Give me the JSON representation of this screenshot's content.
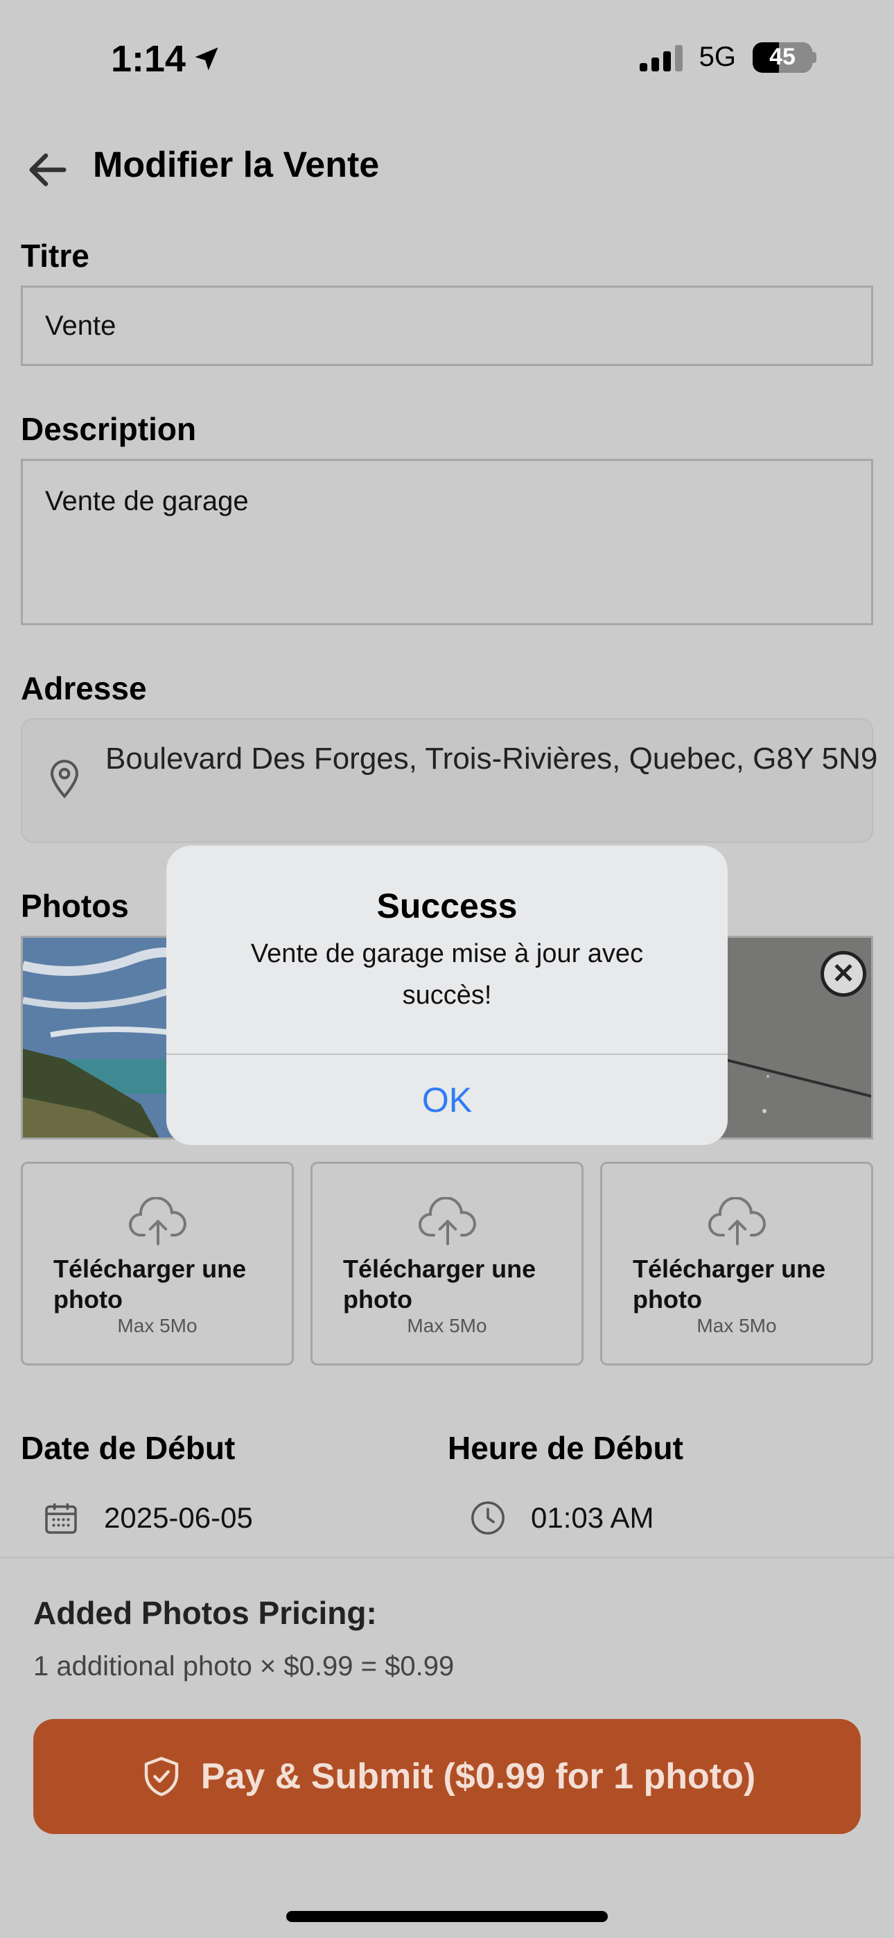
{
  "status_bar": {
    "time": "1:14",
    "network": "5G",
    "battery": "45"
  },
  "header": {
    "title": "Modifier la Vente"
  },
  "form": {
    "title_label": "Titre",
    "title_value": "Vente",
    "description_label": "Description",
    "description_value": "Vente de garage",
    "address_label": "Adresse",
    "address_value": "Boulevard Des Forges, Trois-Rivières, Quebec, G8Y 5N9",
    "photos_label": "Photos",
    "uploads": [
      {
        "label": "Télécharger une photo",
        "max": "Max 5Mo"
      },
      {
        "label": "Télécharger une photo",
        "max": "Max 5Mo"
      },
      {
        "label": "Télécharger une photo",
        "max": "Max 5Mo"
      }
    ],
    "start_date_label": "Date de Début",
    "start_date_value": "2025-06-05",
    "start_time_label": "Heure de Début",
    "start_time_value": "01:03 AM"
  },
  "pricing": {
    "title": "Added Photos Pricing:",
    "line": "1 additional photo × $0.99 = $0.99",
    "pay_button": "Pay & Submit ($0.99 for 1 photo)"
  },
  "alert": {
    "title": "Success",
    "message": "Vente de garage mise à jour avec succès!",
    "ok": "OK"
  },
  "colors": {
    "accent": "#b04f26",
    "link": "#2f7bf5",
    "background": "#cbcbcb"
  }
}
